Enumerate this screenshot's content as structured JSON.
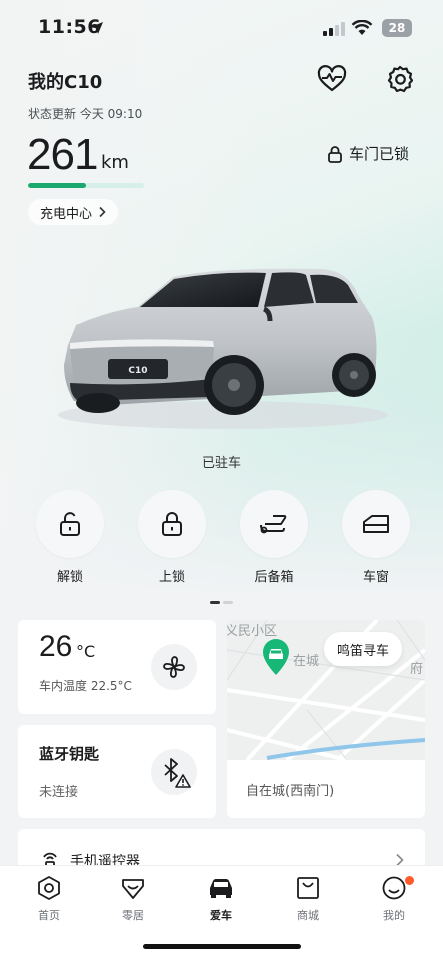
{
  "status_bar": {
    "time": "11:56",
    "battery": "28"
  },
  "header": {
    "car_name": "我的C10",
    "update_label": "状态更新 今天 09:10"
  },
  "range": {
    "value": "261",
    "unit": "km",
    "level": 0.5
  },
  "door_status": "车门已锁",
  "charge_center": "充电中心",
  "car_badge": "C10",
  "parked_label": "已驻车",
  "quick_actions": [
    {
      "label": "解锁",
      "icon": "unlock-icon"
    },
    {
      "label": "上锁",
      "icon": "lock-icon"
    },
    {
      "label": "后备箱",
      "icon": "trunk-icon"
    },
    {
      "label": "车窗",
      "icon": "window-icon"
    }
  ],
  "climate": {
    "temp": "26",
    "unit": "°C",
    "inside_label": "车内温度 22.5°C"
  },
  "bluetooth_key": {
    "title": "蓝牙钥匙",
    "status": "未连接"
  },
  "map": {
    "poi_top": "义民小区",
    "poi_pin": "在城",
    "poi_right": "府",
    "honk_button": "鸣笛寻车",
    "address": "自在城(西南门)"
  },
  "remote": {
    "label": "手机遥控器"
  },
  "tabs": [
    {
      "label": "首页",
      "icon": "home-icon"
    },
    {
      "label": "零居",
      "icon": "heart-shop-icon"
    },
    {
      "label": "爱车",
      "icon": "car-icon",
      "active": true
    },
    {
      "label": "商城",
      "icon": "bag-icon"
    },
    {
      "label": "我的",
      "icon": "profile-icon"
    }
  ],
  "colors": {
    "accent": "#1aa86f",
    "notification": "#ff5a2a",
    "pin": "#17b877"
  }
}
